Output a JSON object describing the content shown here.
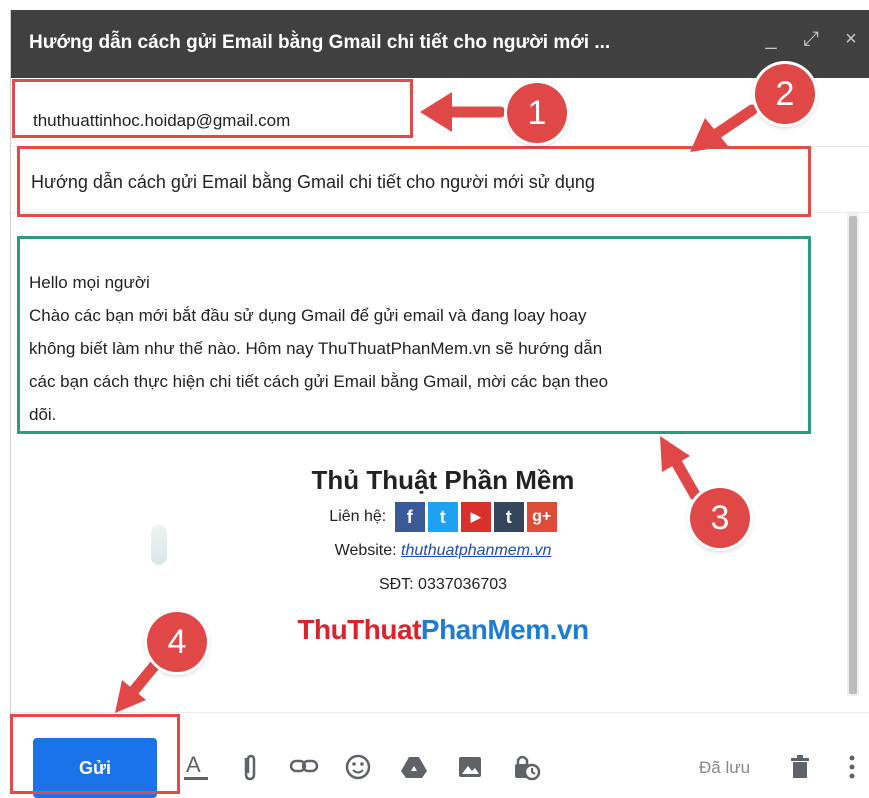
{
  "window": {
    "title": "Hướng dẫn cách gửi Email bằng Gmail chi tiết cho người mới ...",
    "minimize_glyph": "_",
    "expand_glyph": "⤢",
    "close_glyph": "×"
  },
  "compose": {
    "to_value": "thuthuattinhoc.hoidap@gmail.com",
    "subject_value": "Hướng dẫn cách gửi Email bằng Gmail chi tiết cho người mới sử dụng",
    "body_lines": [
      "Hello mọi người",
      "Chào các bạn mới bắt đầu sử dụng Gmail để gửi email và  đang loay hoay",
      "không biết làm như thế nào. Hôm nay ThuThuatPhanMem.vn sẽ hướng dẫn",
      "các bạn cách thực hiện chi tiết cách gửi Email bằng Gmail, mời các bạn theo",
      "dõi."
    ]
  },
  "signature": {
    "name": "Thủ Thuật Phần Mềm",
    "contact_label": "Liên hệ:",
    "social": [
      {
        "icon": "facebook-icon",
        "glyph": "f",
        "color": "#3b5998"
      },
      {
        "icon": "twitter-icon",
        "glyph": "t",
        "color": "#1da1f2"
      },
      {
        "icon": "youtube-icon",
        "glyph": "▶",
        "color": "#d9302c"
      },
      {
        "icon": "tumblr-icon",
        "glyph": "t",
        "color": "#35465c"
      },
      {
        "icon": "google-plus-icon",
        "glyph": "g+",
        "color": "#dd4b39"
      }
    ],
    "website_label": "Website:",
    "website_link": "thuthuatphanmem.vn",
    "phone": "SĐT: 0337036703",
    "brand_part1": "ThuThuat",
    "brand_part2": "PhanMem.vn"
  },
  "toolbar": {
    "send_label": "Gửi",
    "saved_label": "Đã lưu",
    "icons": [
      "formatting-icon",
      "attach-icon",
      "link-icon",
      "emoji-icon",
      "drive-icon",
      "photo-icon",
      "confidential-icon",
      "delete-icon",
      "more-options-icon"
    ]
  },
  "annotations": {
    "badges": [
      "1",
      "2",
      "3",
      "4"
    ],
    "red_color": "#e04b4b",
    "green_color": "#2e9a7e"
  }
}
